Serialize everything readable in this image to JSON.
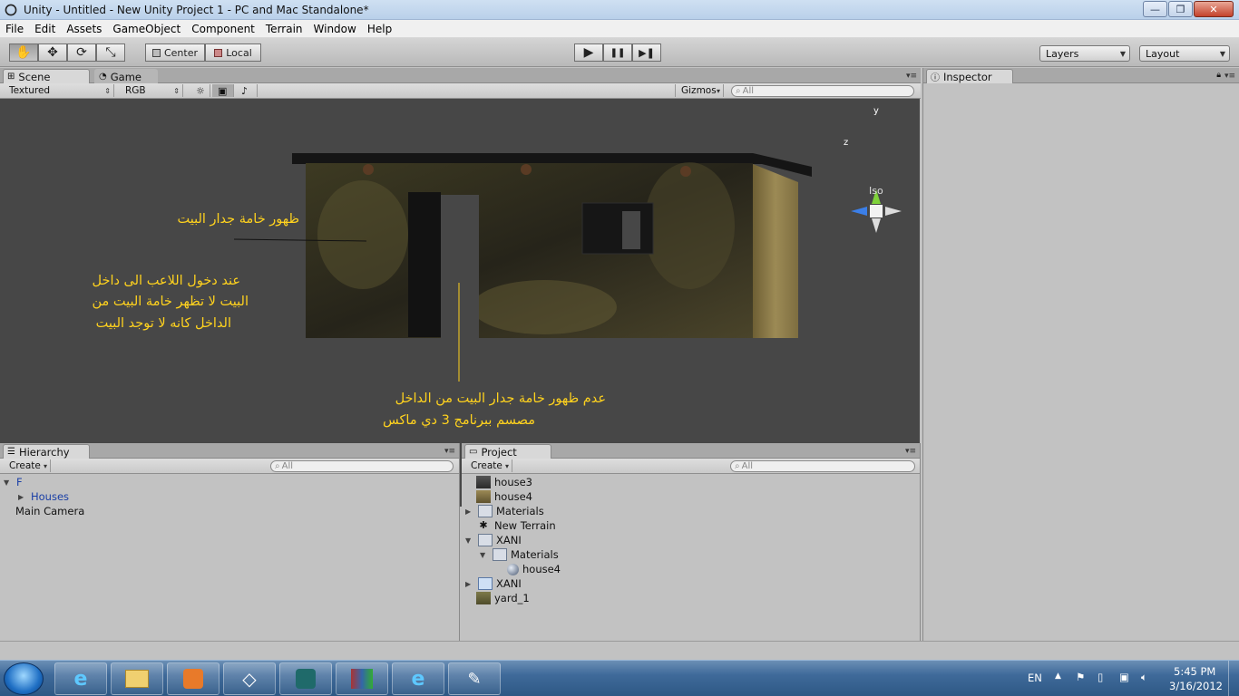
{
  "window": {
    "title": "Unity - Untitled - New Unity Project 1 - PC and Mac Standalone*",
    "minimize_glyph": "—",
    "maximize_glyph": "❐",
    "close_glyph": "✕"
  },
  "menubar": {
    "items": [
      "File",
      "Edit",
      "Assets",
      "GameObject",
      "Component",
      "Terrain",
      "Window",
      "Help"
    ]
  },
  "toolbar": {
    "tools": [
      {
        "name": "hand-tool",
        "glyph": "✋"
      },
      {
        "name": "move-tool",
        "glyph": "✥"
      },
      {
        "name": "rotate-tool",
        "glyph": "⟳"
      },
      {
        "name": "scale-tool",
        "glyph": "⤡"
      }
    ],
    "pivot_label": "Center",
    "space_label": "Local",
    "play_glyph": "▶",
    "pause_glyph": "❚❚",
    "step_glyph": "▶❚",
    "layers_label": "Layers",
    "layout_label": "Layout"
  },
  "scene_panel": {
    "tab_scene": "Scene",
    "tab_game": "Game",
    "render_mode": "Textured",
    "color_mode": "RGB",
    "gizmos_label": "Gizmos",
    "search_placeholder": "All",
    "axis_y": "y",
    "axis_z": "z",
    "projection_label": "Iso",
    "annotations": {
      "texture_shown": "ظهور خامة  جدار البيت",
      "enter_line1": "عند دخول اللاعب الى داخل",
      "enter_line2": "البيت لا تظهر خامة البيت من",
      "enter_line3": "الداخل    كانه لا توجد البيت",
      "inside_line1": "عدم ظهور خامة جدار البيت من الداخل",
      "inside_line2": "مصسم ببرنامج 3 دي ماكس"
    }
  },
  "inspector": {
    "tab_label": "Inspector"
  },
  "hierarchy": {
    "tab_label": "Hierarchy",
    "create_label": "Create",
    "search_placeholder": "All",
    "items": [
      {
        "label": "F"
      },
      {
        "label": "Houses"
      },
      {
        "label": "Main Camera"
      }
    ]
  },
  "project": {
    "tab_label": "Project",
    "create_label": "Create",
    "search_placeholder": "All",
    "items": [
      {
        "label": "house3"
      },
      {
        "label": "house4"
      },
      {
        "label": "Materials"
      },
      {
        "label": "New Terrain"
      },
      {
        "label": "XANI"
      },
      {
        "label": "Materials"
      },
      {
        "label": "house4"
      },
      {
        "label": "XANI"
      },
      {
        "label": "yard_1"
      }
    ]
  },
  "tray": {
    "language": "EN",
    "time": "5:45 PM",
    "date": "3/16/2012"
  }
}
